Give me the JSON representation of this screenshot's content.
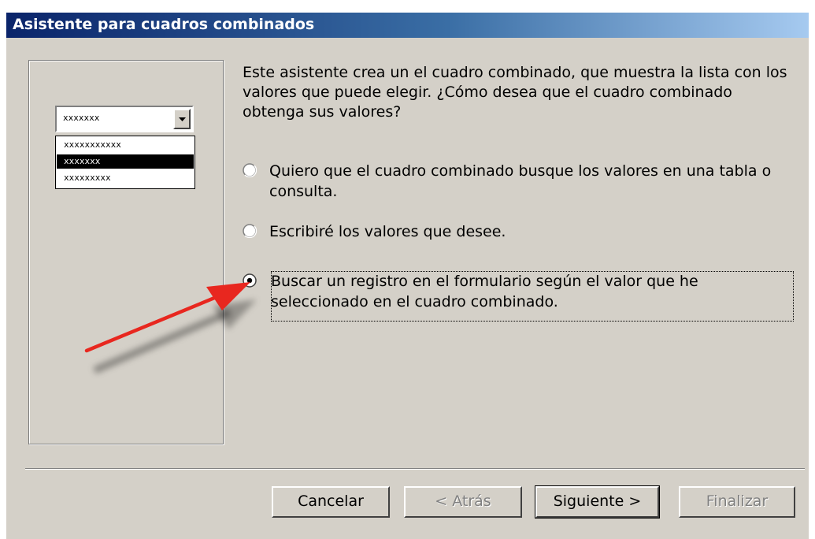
{
  "window": {
    "title": "Asistente para cuadros combinados"
  },
  "preview": {
    "combo_value": "xxxxxxx",
    "list_items": [
      "xxxxxxxxxxx",
      "xxxxxxx",
      "xxxxxxxxx"
    ],
    "selected_index": 1
  },
  "description": "Este asistente crea un el cuadro combinado, que muestra la lista con los valores que puede elegir. ¿Cómo desea que el cuadro combinado obtenga sus valores?",
  "options": [
    {
      "label": "Quiero que el cuadro combinado busque los valores en una tabla o consulta.",
      "selected": false
    },
    {
      "label": "Escribiré los valores que desee.",
      "selected": false
    },
    {
      "label": "Buscar un registro en el formulario según el valor que he seleccionado en el cuadro combinado.",
      "selected": true
    }
  ],
  "buttons": {
    "cancel": "Cancelar",
    "back": "< Atrás",
    "next": "Siguiente >",
    "finish": "Finalizar"
  },
  "colors": {
    "titlebar": "#0a246a",
    "face": "#d4d0c8",
    "arrow": "#e8271f"
  },
  "icons": {
    "dropdown": "chevron-down-icon",
    "annotation": "red-arrow-icon"
  }
}
